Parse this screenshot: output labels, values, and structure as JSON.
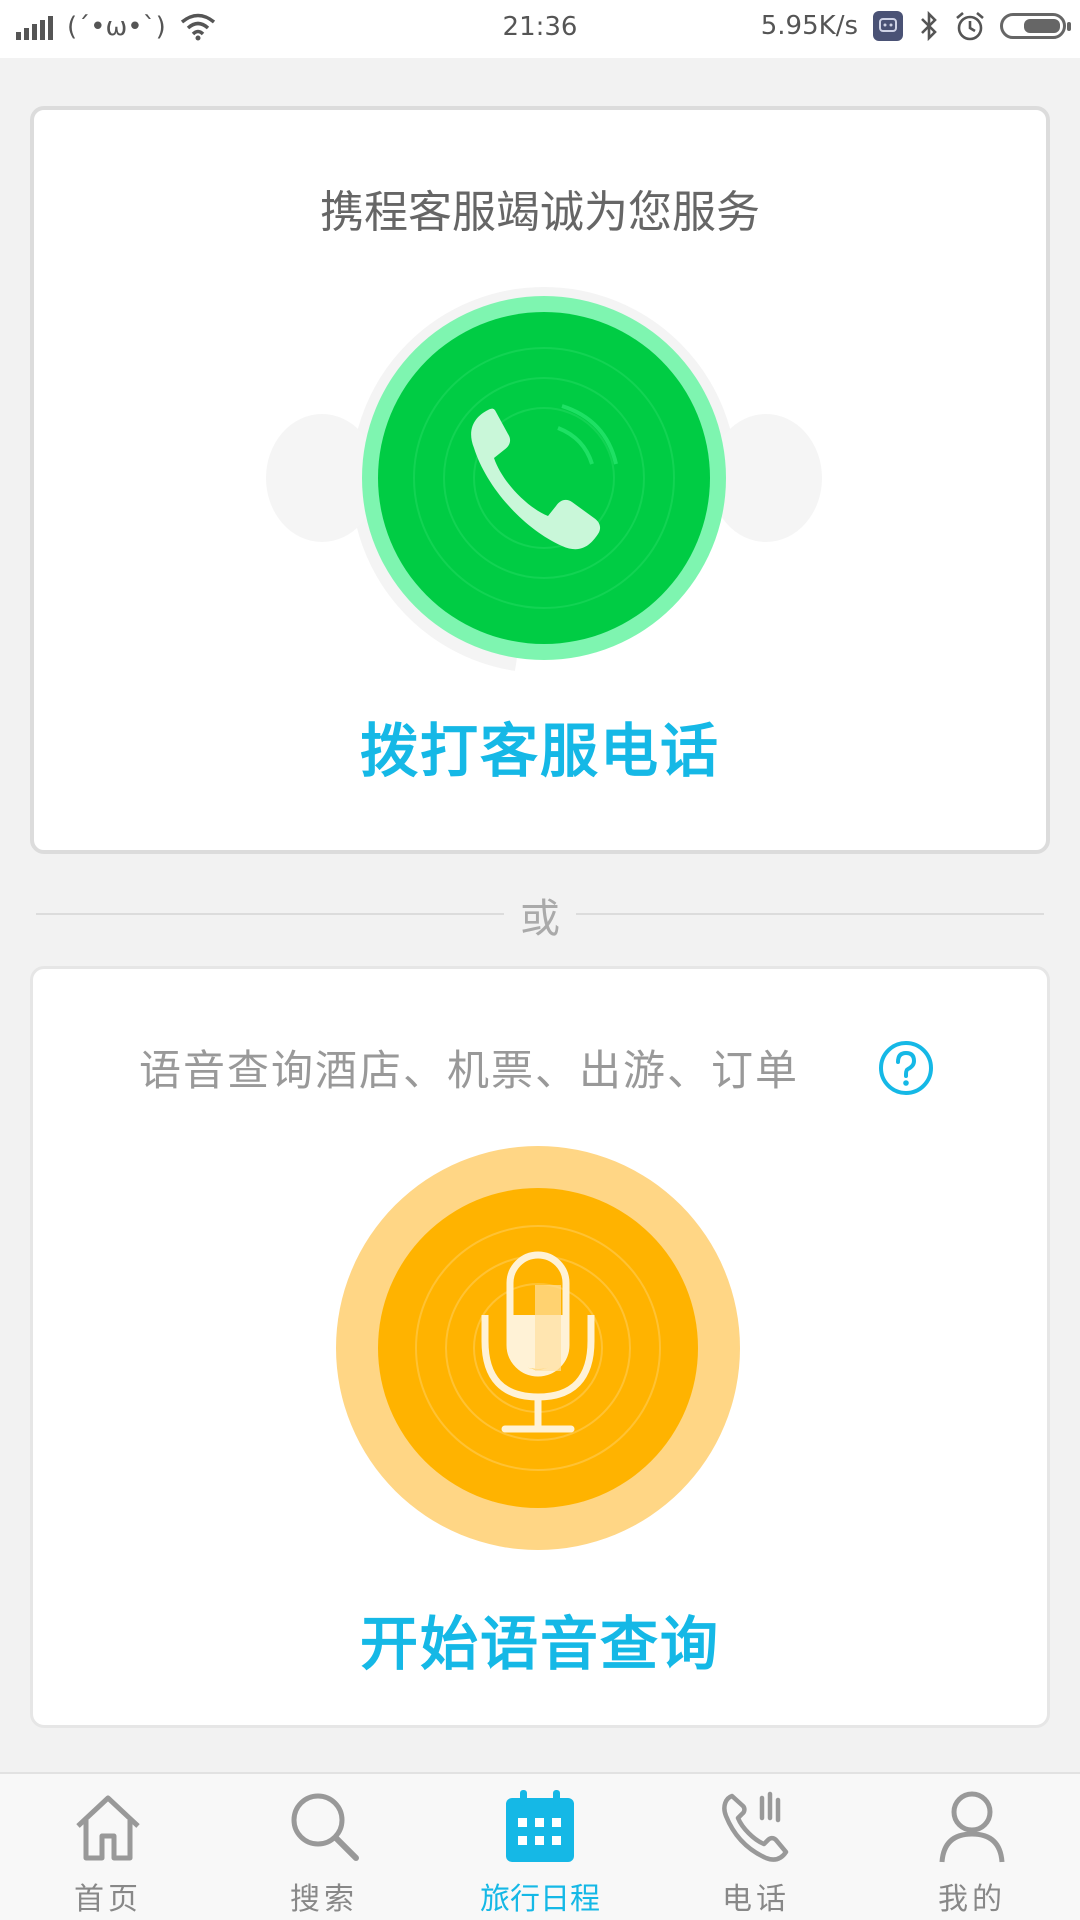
{
  "status_bar": {
    "kaomoji": "(´•ω•`)",
    "time": "21:36",
    "net_speed": "5.95K/s",
    "icons": [
      "signal-icon",
      "wifi-icon",
      "app-icon",
      "bluetooth-icon",
      "alarm-icon",
      "battery-icon"
    ]
  },
  "service_card": {
    "title": "携程客服竭诚为您服务",
    "call_label": "拨打客服电话",
    "icon": "phone-icon",
    "colors": {
      "green": "#00cc44",
      "green_ring": "#7ef5b0"
    }
  },
  "divider": {
    "label": "或"
  },
  "voice_card": {
    "title": "语音查询酒店、机票、出游、订单",
    "help_icon": "question-icon",
    "voice_label": "开始语音查询",
    "icon": "microphone-icon",
    "colors": {
      "orange": "#ffb300",
      "orange_ring": "#ffd685"
    }
  },
  "bottom_nav": {
    "active_index": 2,
    "items": [
      {
        "label": "首页",
        "icon": "home-icon"
      },
      {
        "label": "搜索",
        "icon": "search-icon"
      },
      {
        "label": "旅行日程",
        "icon": "calendar-icon"
      },
      {
        "label": "电话",
        "icon": "phone-icon"
      },
      {
        "label": "我的",
        "icon": "user-icon"
      }
    ],
    "accent_color": "#15b8e6"
  }
}
